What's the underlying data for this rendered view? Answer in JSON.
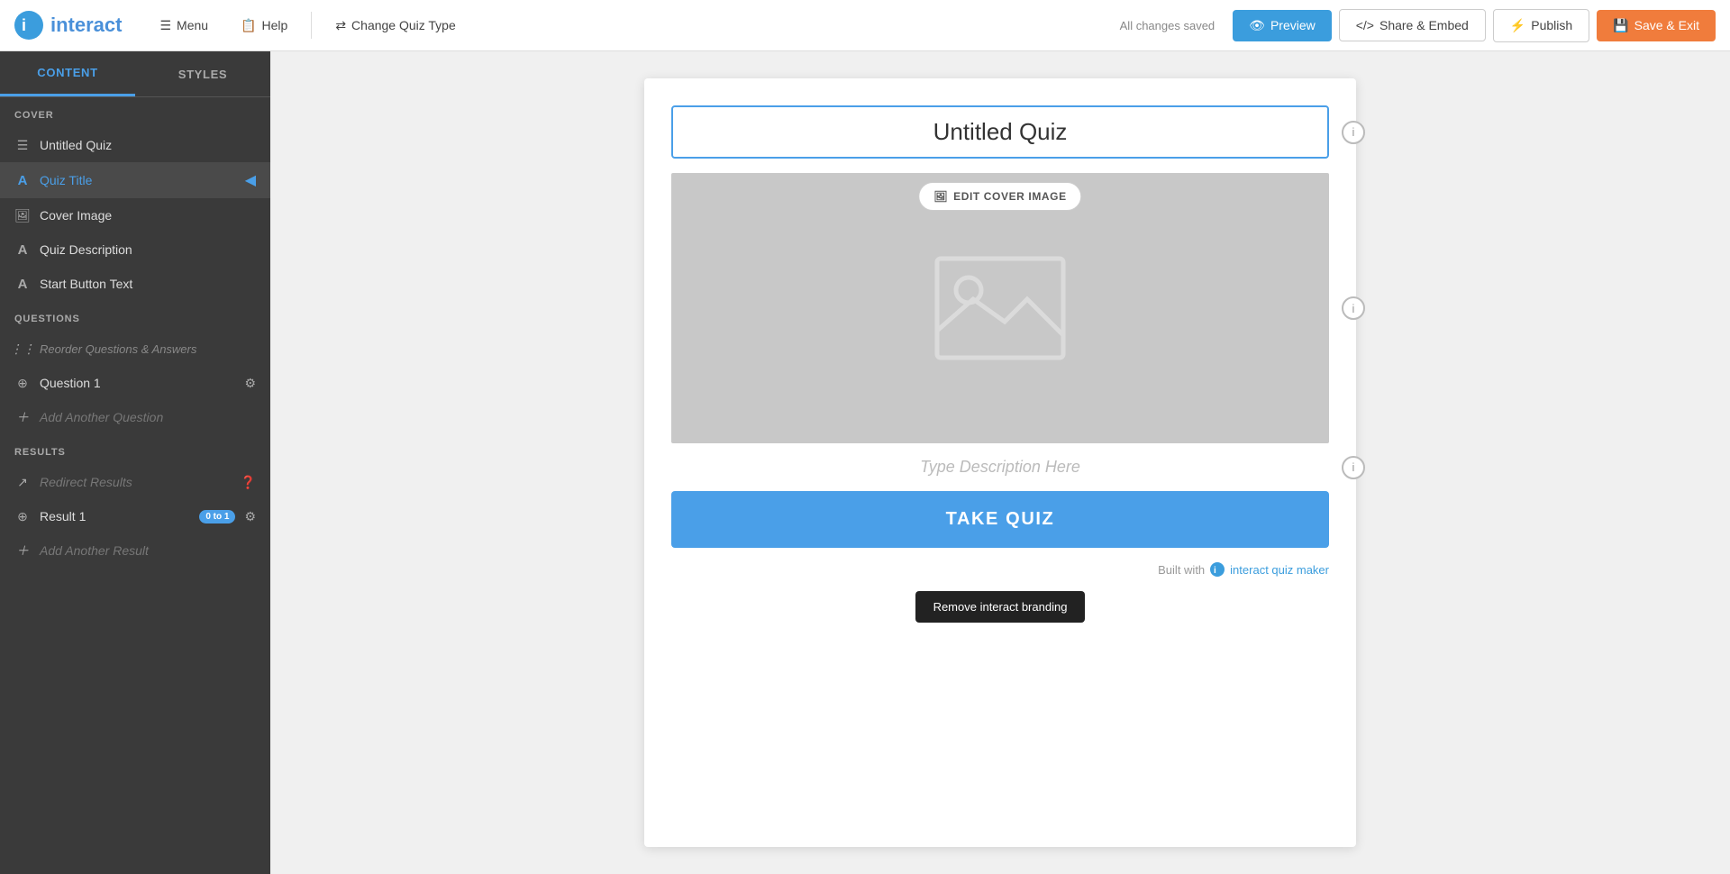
{
  "logo": {
    "icon_text": "🔵",
    "name": "interact"
  },
  "topnav": {
    "menu_label": "Menu",
    "help_label": "Help",
    "change_quiz_type_label": "Change Quiz Type",
    "status_text": "All changes saved",
    "preview_label": "Preview",
    "share_embed_label": "Share & Embed",
    "publish_label": "Publish",
    "save_exit_label": "Save & Exit"
  },
  "sidebar": {
    "tab_content": "CONTENT",
    "tab_styles": "STYLES",
    "cover_header": "COVER",
    "cover_items": [
      {
        "id": "untitled-quiz",
        "label": "Untitled Quiz",
        "icon": "☰"
      },
      {
        "id": "quiz-title",
        "label": "Quiz Title",
        "icon": "A",
        "active": true
      },
      {
        "id": "cover-image",
        "label": "Cover Image",
        "icon": "🖼"
      },
      {
        "id": "quiz-description",
        "label": "Quiz Description",
        "icon": "A"
      },
      {
        "id": "start-button-text",
        "label": "Start Button Text",
        "icon": "A"
      }
    ],
    "questions_header": "QUESTIONS",
    "reorder_label": "Reorder Questions & Answers",
    "question1_label": "Question 1",
    "add_question_label": "Add Another Question",
    "results_header": "RESULTS",
    "redirect_label": "Redirect Results",
    "result1_label": "Result 1",
    "result1_badge": "0 to 1",
    "add_result_label": "Add Another Result"
  },
  "quiz_preview": {
    "title_value": "Untitled Quiz",
    "edit_cover_image_label": "EDIT COVER IMAGE",
    "description_placeholder": "Type Description Here",
    "take_quiz_label": "TAKE QUIZ",
    "built_with_text": "Built with",
    "interact_brand": "interact quiz maker",
    "remove_branding_label": "Remove interact branding"
  }
}
